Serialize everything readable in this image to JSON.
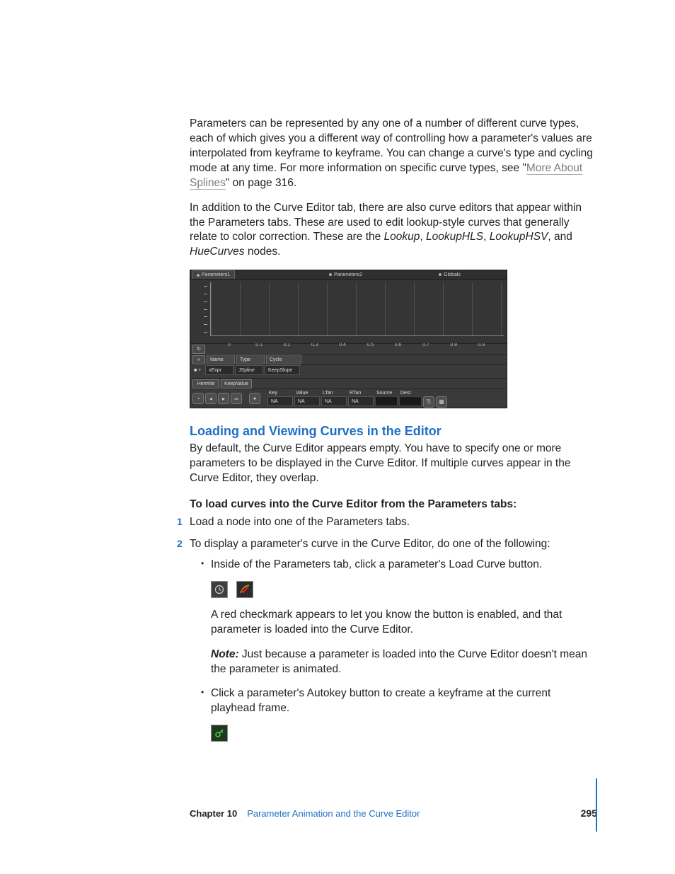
{
  "para1_a": "Parameters can be represented by any one of a number of different curve types, each of which gives you a different way of controlling how a parameter's values are interpolated from keyframe to keyframe. You can change a curve's type and cycling mode at any time. For more information on specific curve types, see \"",
  "para1_link": "More About Splines",
  "para1_b": "\" on page 316.",
  "para2_a": "In addition to the Curve Editor tab, there are also curve editors that appear within the Parameters tabs. These are used to edit lookup-style curves that generally relate to color correction. These are the ",
  "para2_i1": "Lookup",
  "para2_s1": ", ",
  "para2_i2": "LookupHLS",
  "para2_s2": ", ",
  "para2_i3": "LookupHSV",
  "para2_s3": ", and ",
  "para2_i4": "HueCurves",
  "para2_s4": " nodes.",
  "editor": {
    "tabs": {
      "p1": "Parameters1",
      "p2": "Parameters2",
      "g": "Globals"
    },
    "xticks": [
      "0",
      "0.1",
      "0.2",
      "0.3",
      "0.4",
      "0.5",
      "0.6",
      "0.7",
      "0.8",
      "0.9"
    ],
    "columns": {
      "c1": "Name",
      "c2": "Type",
      "c3": "Cycle"
    },
    "row": {
      "marker": "■ +",
      "name": "xExpr",
      "type": "JSpline",
      "cycle": "KeepSlope"
    },
    "buttons": {
      "b1": "Hermite",
      "b2": "KeepValue"
    },
    "fields": {
      "key": "Key",
      "value": "Value",
      "ltan": "LTan",
      "rtan": "RTan",
      "source": "Source",
      "dest": "Dest",
      "na": "NA"
    }
  },
  "heading": "Loading and Viewing Curves in the Editor",
  "para3": "By default, the Curve Editor appears empty. You have to specify one or more parameters to be displayed in the Curve Editor. If multiple curves appear in the Curve Editor, they overlap.",
  "lead": "To load curves into the Curve Editor from the Parameters tabs:",
  "step1_num": "1",
  "step1": "Load a node into one of the Parameters tabs.",
  "step2_num": "2",
  "step2": "To display a parameter's curve in the Curve Editor, do one of the following:",
  "bullet1": "Inside of the Parameters tab, click a parameter's Load Curve button.",
  "after_icons": "A red checkmark appears to let you know the button is enabled, and that parameter is loaded into the Curve Editor.",
  "note_label": "Note:",
  "note_body": "  Just because a parameter is loaded into the Curve Editor doesn't mean the parameter is animated.",
  "bullet2": "Click a parameter's Autokey button to create a keyframe at the current playhead frame.",
  "footer": {
    "chapter": "Chapter 10",
    "title": "Parameter Animation and the Curve Editor",
    "page": "295"
  }
}
